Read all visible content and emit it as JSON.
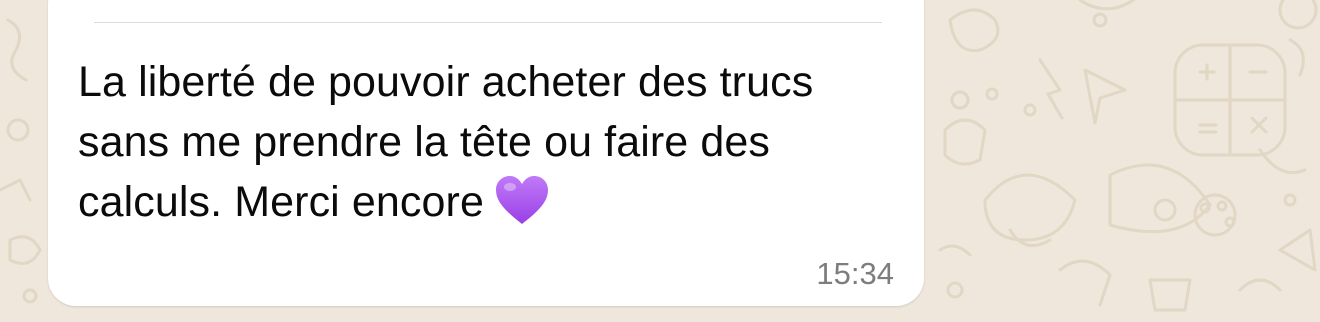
{
  "message": {
    "text": "La liberté de pouvoir acheter des trucs sans me prendre la tête ou faire des calculs. Merci encore",
    "emoji": "purple-heart-icon",
    "time": "15:34"
  },
  "colors": {
    "chat_background": "#efe7dc",
    "bubble": "#ffffff",
    "text": "#0b0b0b",
    "timestamp": "#7d7d7d",
    "heart": "#a64df0"
  }
}
